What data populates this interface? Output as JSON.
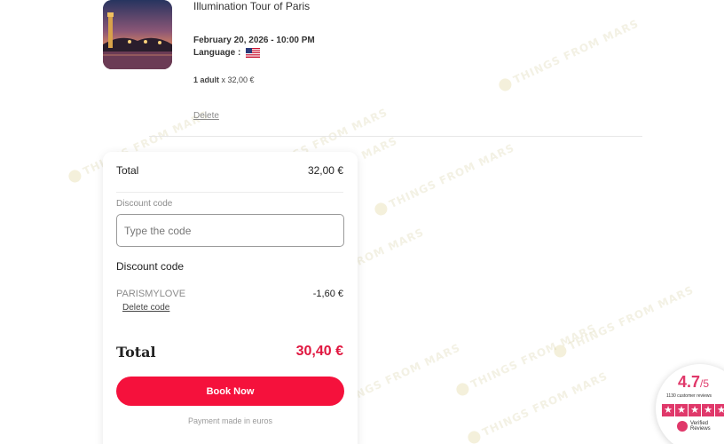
{
  "item": {
    "title": "Illumination Tour of Paris",
    "datetime": "February 20, 2026 - 10:00 PM",
    "language_label": "Language :",
    "quantity_label": "1 adult",
    "quantity_price": "x 32,00 €",
    "delete_label": "Delete"
  },
  "summary": {
    "total_label": "Total",
    "total_value": "32,00 €",
    "discount_field_label": "Discount code",
    "discount_placeholder": "Type the code",
    "discount_heading": "Discount code",
    "promo_code": "PARISMYLOVE",
    "promo_amount": "-1,60 €",
    "delete_code_label": "Delete code",
    "grand_total_label": "Total",
    "grand_total_value": "30,40 €",
    "book_button_label": "Book Now",
    "payment_note": "Payment made in euros"
  },
  "reviews_badge": {
    "score": "4.7",
    "scale": "/5",
    "count_text": "1130 customer reviews",
    "logo_text_1": "Verified",
    "logo_text_2": "Reviews"
  },
  "watermark_text": "THINGS FROM MARS",
  "colors": {
    "accent": "#f5113c",
    "total_red": "#e0163f",
    "badge_pink": "#e0386a"
  }
}
